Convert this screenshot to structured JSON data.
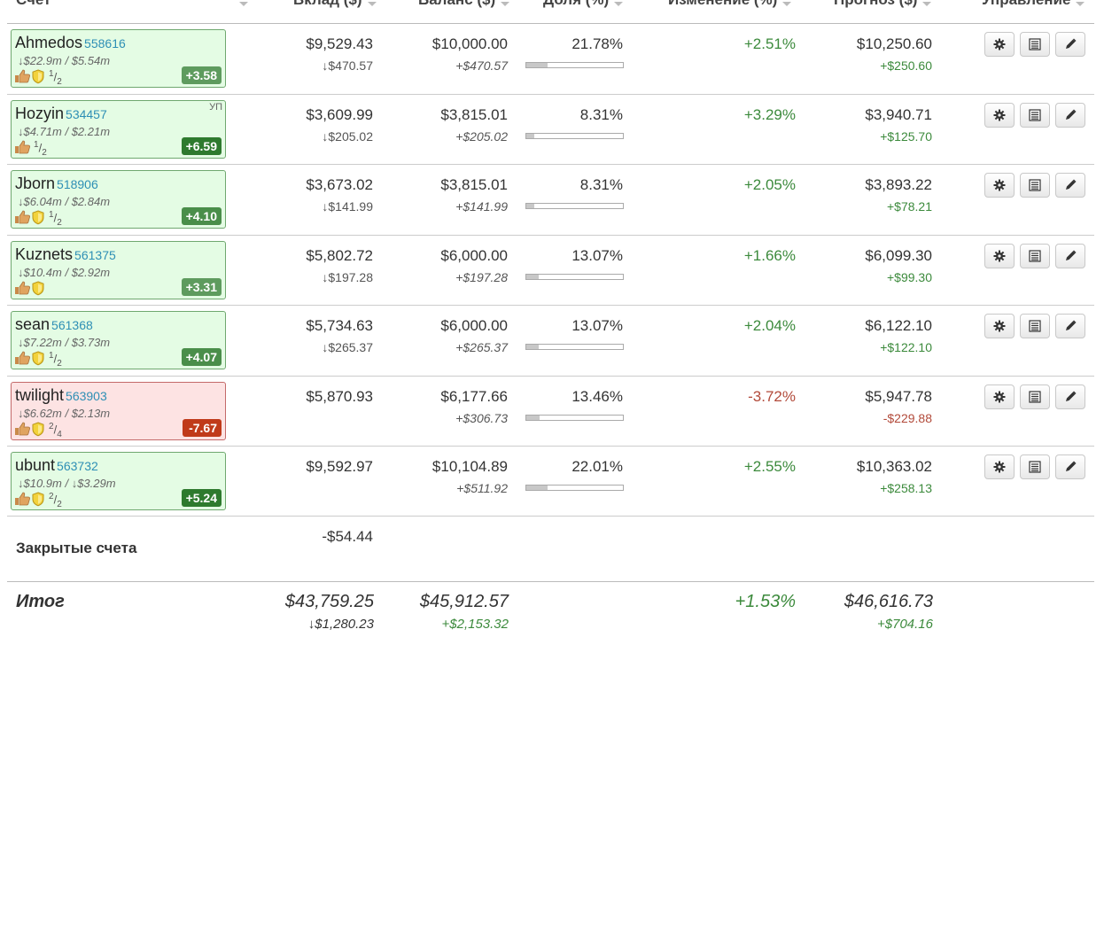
{
  "headers": {
    "account": "Счет",
    "deposit": "Вклад ($)",
    "balance": "Баланс ($)",
    "share": "Доля (%)",
    "change": "Изменение (%)",
    "forecast": "Прогноз ($)",
    "manage": "Управление"
  },
  "accounts": [
    {
      "name": "Ahmedos",
      "id": "558616",
      "tag": "",
      "sub": "↓$22.9m / $5.54m",
      "shield": true,
      "frac_num": "1",
      "frac_den": "2",
      "badge": "+3.58",
      "badge_color": "#5e9b5e",
      "status": "positive",
      "deposit": "$9,529.43",
      "deposit_sub": "↓$470.57",
      "balance": "$10,000.00",
      "balance_sub": "+$470.57",
      "share": "21.78%",
      "share_value": 21.78,
      "change": "+2.51%",
      "change_sign": "pos",
      "forecast": "$10,250.60",
      "forecast_sub": "+$250.60",
      "forecast_sign": "pos"
    },
    {
      "name": "Hozyin",
      "id": "534457",
      "tag": "УП",
      "sub": "↓$4.71m / $2.21m",
      "shield": false,
      "frac_num": "1",
      "frac_den": "2",
      "badge": "+6.59",
      "badge_color": "#2e7a2e",
      "status": "positive",
      "deposit": "$3,609.99",
      "deposit_sub": "↓$205.02",
      "balance": "$3,815.01",
      "balance_sub": "+$205.02",
      "share": "8.31%",
      "share_value": 8.31,
      "change": "+3.29%",
      "change_sign": "pos",
      "forecast": "$3,940.71",
      "forecast_sub": "+$125.70",
      "forecast_sign": "pos"
    },
    {
      "name": "Jborn",
      "id": "518906",
      "tag": "",
      "sub": "↓$6.04m / $2.84m",
      "shield": true,
      "frac_num": "1",
      "frac_den": "2",
      "badge": "+4.10",
      "badge_color": "#4a8e4a",
      "status": "positive",
      "deposit": "$3,673.02",
      "deposit_sub": "↓$141.99",
      "balance": "$3,815.01",
      "balance_sub": "+$141.99",
      "share": "8.31%",
      "share_value": 8.31,
      "change": "+2.05%",
      "change_sign": "pos",
      "forecast": "$3,893.22",
      "forecast_sub": "+$78.21",
      "forecast_sign": "pos"
    },
    {
      "name": "Kuznets",
      "id": "561375",
      "tag": "",
      "sub": "↓$10.4m / $2.92m",
      "shield": true,
      "frac_num": "",
      "frac_den": "",
      "badge": "+3.31",
      "badge_color": "#5e9b5e",
      "status": "positive",
      "deposit": "$5,802.72",
      "deposit_sub": "↓$197.28",
      "balance": "$6,000.00",
      "balance_sub": "+$197.28",
      "share": "13.07%",
      "share_value": 13.07,
      "change": "+1.66%",
      "change_sign": "pos",
      "forecast": "$6,099.30",
      "forecast_sub": "+$99.30",
      "forecast_sign": "pos"
    },
    {
      "name": "sean",
      "id": "561368",
      "tag": "",
      "sub": "↓$7.22m / $3.73m",
      "shield": true,
      "frac_num": "1",
      "frac_den": "2",
      "badge": "+4.07",
      "badge_color": "#4a8e4a",
      "status": "positive",
      "deposit": "$5,734.63",
      "deposit_sub": "↓$265.37",
      "balance": "$6,000.00",
      "balance_sub": "+$265.37",
      "share": "13.07%",
      "share_value": 13.07,
      "change": "+2.04%",
      "change_sign": "pos",
      "forecast": "$6,122.10",
      "forecast_sub": "+$122.10",
      "forecast_sign": "pos"
    },
    {
      "name": "twilight",
      "id": "563903",
      "tag": "",
      "sub": "↓$6.62m / $2.13m",
      "shield": true,
      "frac_num": "2",
      "frac_den": "4",
      "badge": "-7.67",
      "badge_color": "#c03a1a",
      "status": "negative",
      "deposit": "$5,870.93",
      "deposit_sub": "",
      "balance": "$6,177.66",
      "balance_sub": "+$306.73",
      "share": "13.46%",
      "share_value": 13.46,
      "change": "-3.72%",
      "change_sign": "neg",
      "forecast": "$5,947.78",
      "forecast_sub": "-$229.88",
      "forecast_sign": "neg"
    },
    {
      "name": "ubunt",
      "id": "563732",
      "tag": "",
      "sub": "↓$10.9m / ↓$3.29m",
      "shield": true,
      "frac_num": "2",
      "frac_den": "2",
      "badge": "+5.24",
      "badge_color": "#2e7a2e",
      "status": "positive",
      "deposit": "$9,592.97",
      "deposit_sub": "",
      "balance": "$10,104.89",
      "balance_sub": "+$511.92",
      "share": "22.01%",
      "share_value": 22.01,
      "change": "+2.55%",
      "change_sign": "pos",
      "forecast": "$10,363.02",
      "forecast_sub": "+$258.13",
      "forecast_sign": "pos"
    }
  ],
  "closed": {
    "label": "Закрытые счета",
    "deposit": "-$54.44"
  },
  "total": {
    "label": "Итог",
    "deposit": "$43,759.25",
    "deposit_sub": "↓$1,280.23",
    "balance": "$45,912.57",
    "balance_sub": "+$2,153.32",
    "change": "+1.53%",
    "forecast": "$46,616.73",
    "forecast_sub": "+$704.16"
  },
  "icons": {
    "settings": "gear-icon",
    "list": "list-icon",
    "edit": "pencil-icon",
    "rating": "thumbs-up-icon",
    "trust": "shield-icon"
  },
  "colors": {
    "positive": "#3c8a3c",
    "negative": "#b24a3a",
    "card_positive_bg": "#e4fce4",
    "card_negative_bg": "#fde3e3",
    "link": "#2e8fb5"
  }
}
